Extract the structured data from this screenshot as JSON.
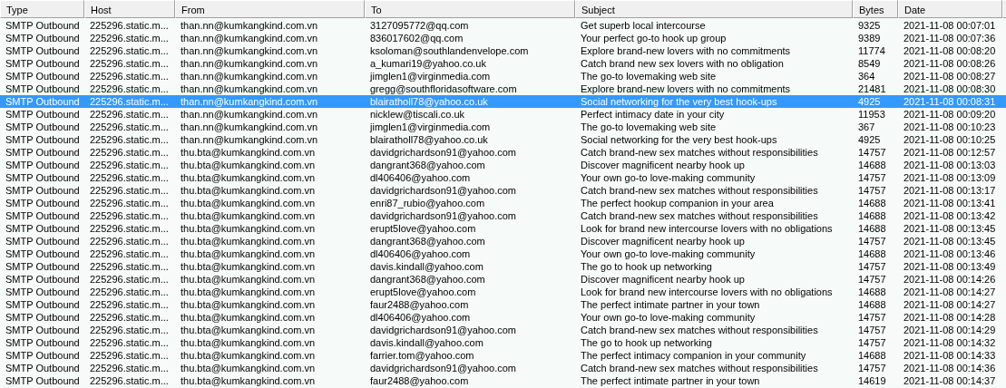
{
  "table": {
    "columns": [
      "Type",
      "Host",
      "From",
      "To",
      "Subject",
      "Bytes",
      "Date"
    ],
    "rows": [
      {
        "type": "SMTP Outbound",
        "host": "225296.static.m...",
        "from": "than.nn@kumkangkind.com.vn",
        "to": "3127095772@qq.com",
        "subject": "Get superb local intercourse",
        "bytes": "9325",
        "date": "2021-11-08 00:07:01",
        "selected": false
      },
      {
        "type": "SMTP Outbound",
        "host": "225296.static.m...",
        "from": "than.nn@kumkangkind.com.vn",
        "to": "836017602@qq.com",
        "subject": "Your perfect go-to hook up group",
        "bytes": "9389",
        "date": "2021-11-08 00:07:36",
        "selected": false
      },
      {
        "type": "SMTP Outbound",
        "host": "225296.static.m...",
        "from": "than.nn@kumkangkind.com.vn",
        "to": "ksoloman@southlandenvelope.com",
        "subject": "Explore brand-new lovers with no commitments",
        "bytes": "11774",
        "date": "2021-11-08 00:08:20",
        "selected": false
      },
      {
        "type": "SMTP Outbound",
        "host": "225296.static.m...",
        "from": "than.nn@kumkangkind.com.vn",
        "to": "a_kumari19@yahoo.co.uk",
        "subject": "Catch brand new sex lovers with no obligation",
        "bytes": "8549",
        "date": "2021-11-08 00:08:26",
        "selected": false
      },
      {
        "type": "SMTP Outbound",
        "host": "225296.static.m...",
        "from": "than.nn@kumkangkind.com.vn",
        "to": "jimglen1@virginmedia.com",
        "subject": "The go-to lovemaking web site",
        "bytes": "364",
        "date": "2021-11-08 00:08:27",
        "selected": false
      },
      {
        "type": "SMTP Outbound",
        "host": "225296.static.m...",
        "from": "than.nn@kumkangkind.com.vn",
        "to": "gregg@southfloridasoftware.com",
        "subject": "Explore brand-new lovers with no commitments",
        "bytes": "21481",
        "date": "2021-11-08 00:08:30",
        "selected": false
      },
      {
        "type": "SMTP Outbound",
        "host": "225296.static.m...",
        "from": "than.nn@kumkangkind.com.vn",
        "to": "blairatholl78@yahoo.co.uk",
        "subject": "Social networking for the very best hook-ups",
        "bytes": "4925",
        "date": "2021-11-08 00:08:31",
        "selected": true
      },
      {
        "type": "SMTP Outbound",
        "host": "225296.static.m...",
        "from": "than.nn@kumkangkind.com.vn",
        "to": "nicklew@tiscali.co.uk",
        "subject": "Perfect intimacy date in your city",
        "bytes": "11953",
        "date": "2021-11-08 00:09:20",
        "selected": false
      },
      {
        "type": "SMTP Outbound",
        "host": "225296.static.m...",
        "from": "than.nn@kumkangkind.com.vn",
        "to": "jimglen1@virginmedia.com",
        "subject": "The go-to lovemaking web site",
        "bytes": "367",
        "date": "2021-11-08 00:10:23",
        "selected": false
      },
      {
        "type": "SMTP Outbound",
        "host": "225296.static.m...",
        "from": "than.nn@kumkangkind.com.vn",
        "to": "blairatholl78@yahoo.co.uk",
        "subject": "Social networking for the very best hook-ups",
        "bytes": "4925",
        "date": "2021-11-08 00:10:25",
        "selected": false
      },
      {
        "type": "SMTP Outbound",
        "host": "225296.static.m...",
        "from": "thu.bta@kumkangkind.com.vn",
        "to": "davidgrichardson91@yahoo.com",
        "subject": "Catch brand-new sex matches without responsibilities",
        "bytes": "14757",
        "date": "2021-11-08 00:12:57",
        "selected": false
      },
      {
        "type": "SMTP Outbound",
        "host": "225296.static.m...",
        "from": "thu.bta@kumkangkind.com.vn",
        "to": "dangrant368@yahoo.com",
        "subject": "Discover magnificent nearby hook up",
        "bytes": "14688",
        "date": "2021-11-08 00:13:03",
        "selected": false
      },
      {
        "type": "SMTP Outbound",
        "host": "225296.static.m...",
        "from": "thu.bta@kumkangkind.com.vn",
        "to": "dl406406@yahoo.com",
        "subject": "Your own go-to love-making community",
        "bytes": "14757",
        "date": "2021-11-08 00:13:09",
        "selected": false
      },
      {
        "type": "SMTP Outbound",
        "host": "225296.static.m...",
        "from": "thu.bta@kumkangkind.com.vn",
        "to": "davidgrichardson91@yahoo.com",
        "subject": "Catch brand-new sex matches without responsibilities",
        "bytes": "14757",
        "date": "2021-11-08 00:13:17",
        "selected": false
      },
      {
        "type": "SMTP Outbound",
        "host": "225296.static.m...",
        "from": "thu.bta@kumkangkind.com.vn",
        "to": "enri87_rubio@yahoo.com",
        "subject": "The perfect hookup companion in your area",
        "bytes": "14688",
        "date": "2021-11-08 00:13:41",
        "selected": false
      },
      {
        "type": "SMTP Outbound",
        "host": "225296.static.m...",
        "from": "thu.bta@kumkangkind.com.vn",
        "to": "davidgrichardson91@yahoo.com",
        "subject": "Catch brand-new sex matches without responsibilities",
        "bytes": "14688",
        "date": "2021-11-08 00:13:42",
        "selected": false
      },
      {
        "type": "SMTP Outbound",
        "host": "225296.static.m...",
        "from": "thu.bta@kumkangkind.com.vn",
        "to": "erupt5love@yahoo.com",
        "subject": "Look for brand new intercourse lovers with no obligations",
        "bytes": "14688",
        "date": "2021-11-08 00:13:45",
        "selected": false
      },
      {
        "type": "SMTP Outbound",
        "host": "225296.static.m...",
        "from": "thu.bta@kumkangkind.com.vn",
        "to": "dangrant368@yahoo.com",
        "subject": "Discover magnificent nearby hook up",
        "bytes": "14757",
        "date": "2021-11-08 00:13:45",
        "selected": false
      },
      {
        "type": "SMTP Outbound",
        "host": "225296.static.m...",
        "from": "thu.bta@kumkangkind.com.vn",
        "to": "dl406406@yahoo.com",
        "subject": "Your own go-to love-making community",
        "bytes": "14688",
        "date": "2021-11-08 00:13:46",
        "selected": false
      },
      {
        "type": "SMTP Outbound",
        "host": "225296.static.m...",
        "from": "thu.bta@kumkangkind.com.vn",
        "to": "davis.kindall@yahoo.com",
        "subject": "The go to hook up networking",
        "bytes": "14757",
        "date": "2021-11-08 00:13:49",
        "selected": false
      },
      {
        "type": "SMTP Outbound",
        "host": "225296.static.m...",
        "from": "thu.bta@kumkangkind.com.vn",
        "to": "dangrant368@yahoo.com",
        "subject": "Discover magnificent nearby hook up",
        "bytes": "14757",
        "date": "2021-11-08 00:14:26",
        "selected": false
      },
      {
        "type": "SMTP Outbound",
        "host": "225296.static.m...",
        "from": "thu.bta@kumkangkind.com.vn",
        "to": "erupt5love@yahoo.com",
        "subject": "Look for brand new intercourse lovers with no obligations",
        "bytes": "14688",
        "date": "2021-11-08 00:14:27",
        "selected": false
      },
      {
        "type": "SMTP Outbound",
        "host": "225296.static.m...",
        "from": "thu.bta@kumkangkind.com.vn",
        "to": "faur2488@yahoo.com",
        "subject": "The perfect intimate partner in your town",
        "bytes": "14688",
        "date": "2021-11-08 00:14:27",
        "selected": false
      },
      {
        "type": "SMTP Outbound",
        "host": "225296.static.m...",
        "from": "thu.bta@kumkangkind.com.vn",
        "to": "dl406406@yahoo.com",
        "subject": "Your own go-to love-making community",
        "bytes": "14757",
        "date": "2021-11-08 00:14:28",
        "selected": false
      },
      {
        "type": "SMTP Outbound",
        "host": "225296.static.m...",
        "from": "thu.bta@kumkangkind.com.vn",
        "to": "davidgrichardson91@yahoo.com",
        "subject": "Catch brand-new sex matches without responsibilities",
        "bytes": "14757",
        "date": "2021-11-08 00:14:29",
        "selected": false
      },
      {
        "type": "SMTP Outbound",
        "host": "225296.static.m...",
        "from": "thu.bta@kumkangkind.com.vn",
        "to": "davis.kindall@yahoo.com",
        "subject": "The go to hook up networking",
        "bytes": "14757",
        "date": "2021-11-08 00:14:32",
        "selected": false
      },
      {
        "type": "SMTP Outbound",
        "host": "225296.static.m...",
        "from": "thu.bta@kumkangkind.com.vn",
        "to": "farrier.tom@yahoo.com",
        "subject": "The perfect intimacy companion in your community",
        "bytes": "14688",
        "date": "2021-11-08 00:14:33",
        "selected": false
      },
      {
        "type": "SMTP Outbound",
        "host": "225296.static.m...",
        "from": "thu.bta@kumkangkind.com.vn",
        "to": "davidgrichardson91@yahoo.com",
        "subject": "Catch brand-new sex matches without responsibilities",
        "bytes": "14757",
        "date": "2021-11-08 00:14:36",
        "selected": false
      },
      {
        "type": "SMTP Outbound",
        "host": "225296.static.m...",
        "from": "thu.bta@kumkangkind.com.vn",
        "to": "faur2488@yahoo.com",
        "subject": "The perfect intimate partner in your town",
        "bytes": "14619",
        "date": "2021-11-08 00:14:37",
        "selected": false
      }
    ]
  }
}
